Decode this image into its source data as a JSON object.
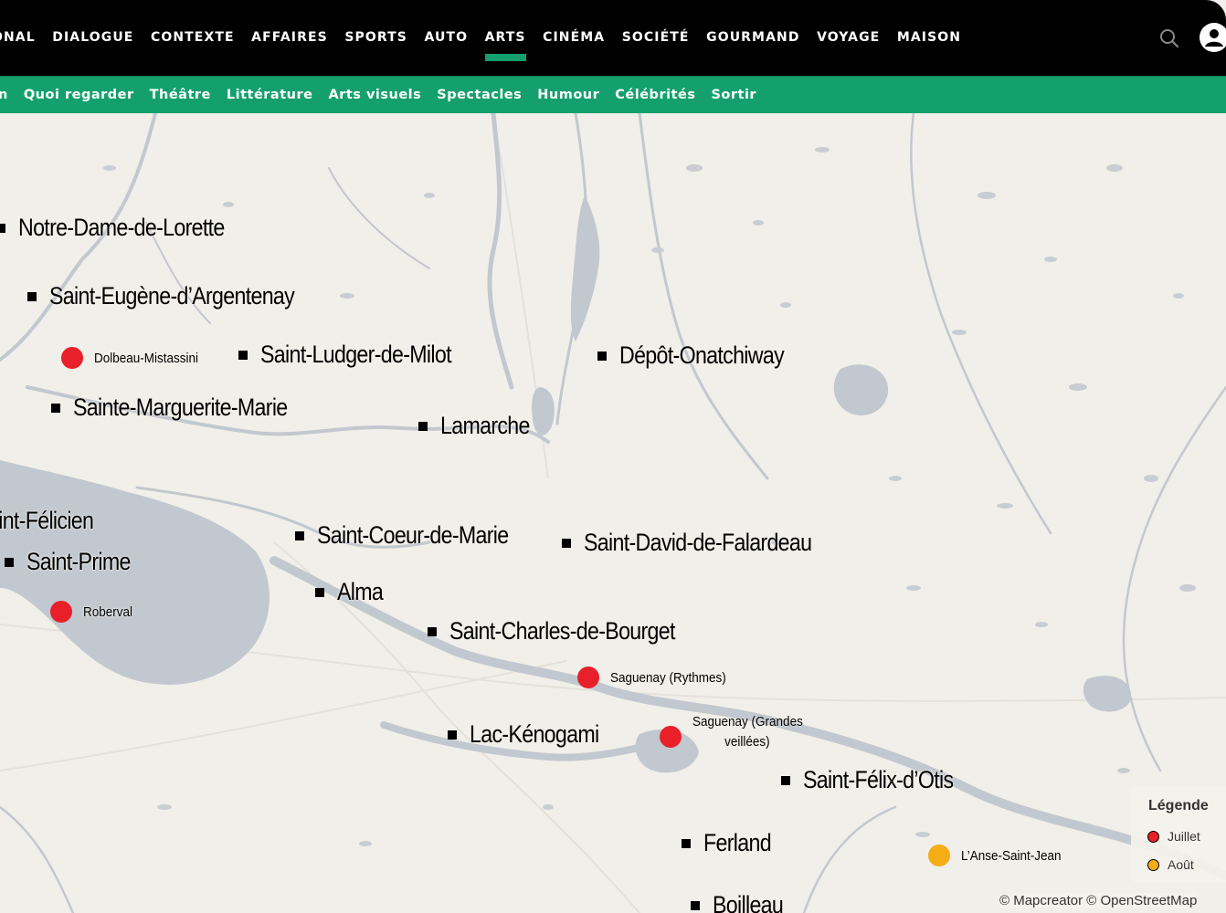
{
  "top_nav": {
    "items": [
      "TIONAL",
      "DIALOGUE",
      "CONTEXTE",
      "AFFAIRES",
      "SPORTS",
      "AUTO",
      "ARTS",
      "CINÉMA",
      "SOCIÉTÉ",
      "GOURMAND",
      "VOYAGE",
      "MAISON"
    ],
    "active": "ARTS",
    "search_icon": "search-icon",
    "account_icon": "user-icon"
  },
  "sub_nav": {
    "items": [
      "n",
      "Quoi regarder",
      "Théâtre",
      "Littérature",
      "Arts visuels",
      "Spectacles",
      "Humour",
      "Célébrités",
      "Sortir"
    ]
  },
  "map": {
    "places": [
      "Notre-Dame-de-Lorette",
      "Saint-Eugène-d’Argentenay",
      "Saint-Ludger-de-Milot",
      "Dépôt-Onatchiway",
      "Sainte-Marguerite-Marie",
      "Lamarche",
      "aint-Félicien",
      "Saint-Prime",
      "Saint-Coeur-de-Marie",
      "Saint-David-de-Falardeau",
      "Alma",
      "Saint-Charles-de-Bourget",
      "Lac-Kénogami",
      "Saint-Félix-d’Otis",
      "Ferland",
      "Boilleau"
    ],
    "events": {
      "dolbeau": "Dolbeau-Mistassini",
      "roberval": "Roberval",
      "rythmes": "Saguenay (Rythmes)",
      "grandes_1": "Saguenay (Grandes",
      "grandes_2": "veillées)",
      "anse": "L’Anse-Saint-Jean"
    },
    "colors": {
      "juillet": "#e8202a",
      "aout": "#f5ad16",
      "water": "#c2c8cf",
      "land": "#f1efe9"
    }
  },
  "legend": {
    "title": "Légende",
    "juillet": "Juillet",
    "aout": "Août"
  },
  "credit": "© Mapcreator © OpenStreetMap"
}
